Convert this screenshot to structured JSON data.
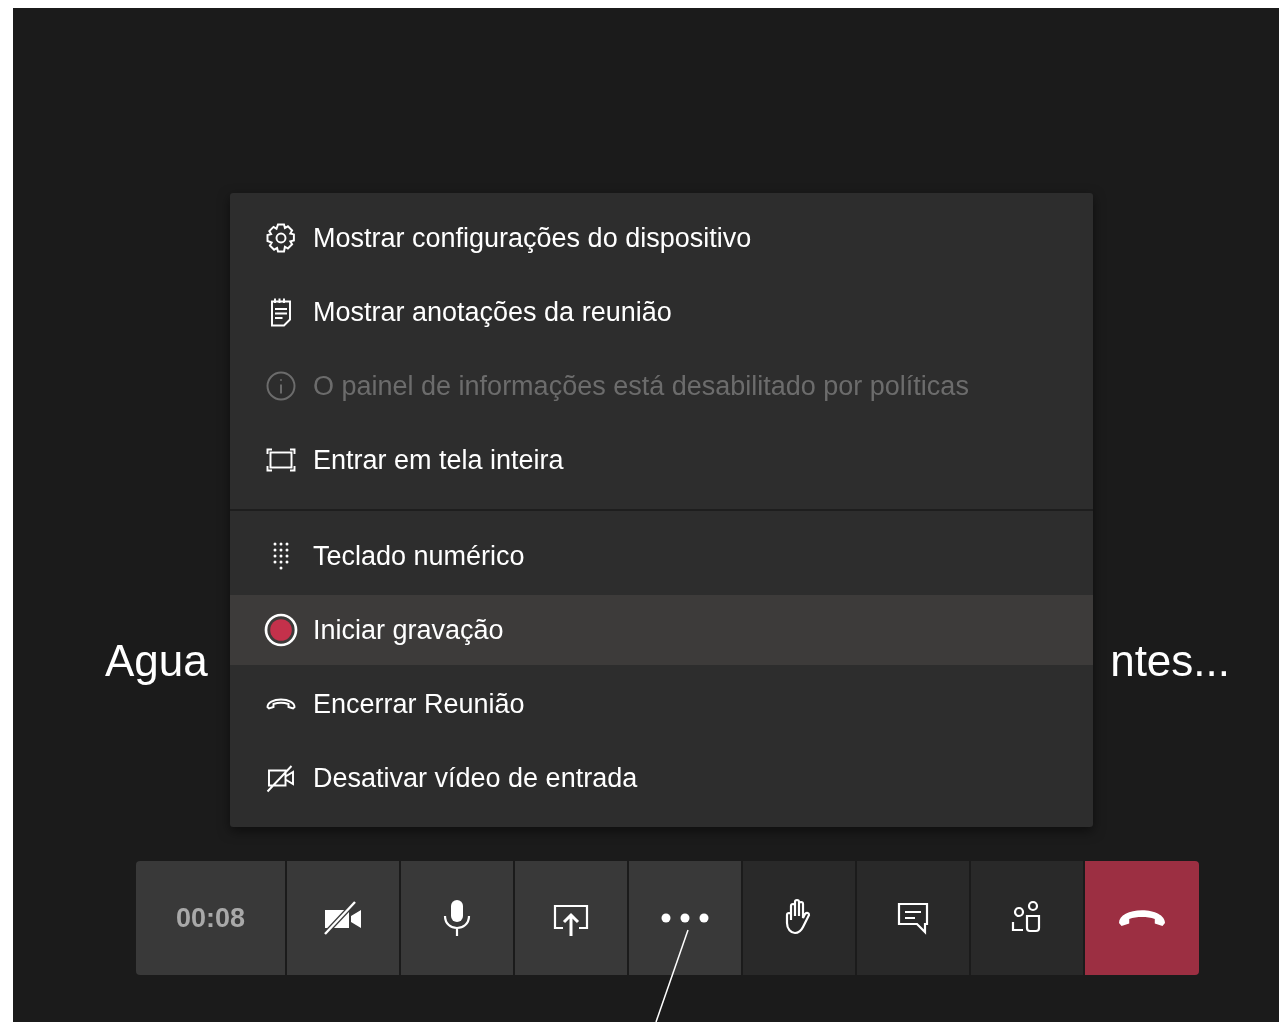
{
  "stage_title": {
    "left_part": "Agua",
    "right_part": "ntes..."
  },
  "menu": {
    "sections": [
      [
        {
          "label": "Mostrar configurações do dispositivo",
          "kind": "gear",
          "disabled": false,
          "highlighted": false
        },
        {
          "label": "Mostrar anotações da reunião",
          "kind": "notes",
          "disabled": false,
          "highlighted": false
        },
        {
          "label": "O painel de informações está desabilitado por políticas",
          "kind": "info",
          "disabled": true,
          "highlighted": false
        },
        {
          "label": "Entrar em tela inteira",
          "kind": "fullscreen",
          "disabled": false,
          "highlighted": false
        }
      ],
      [
        {
          "label": "Teclado numérico",
          "kind": "keypad",
          "disabled": false,
          "highlighted": false
        },
        {
          "label": "Iniciar gravação",
          "kind": "record",
          "disabled": false,
          "highlighted": true
        },
        {
          "label": "Encerrar Reunião",
          "kind": "hangup",
          "disabled": false,
          "highlighted": false
        },
        {
          "label": "Desativar vídeo de entrada",
          "kind": "video-off",
          "disabled": false,
          "highlighted": false
        }
      ]
    ]
  },
  "toolbar": {
    "timer": "00:08",
    "buttons": [
      {
        "kind": "camera-off",
        "highlighted": true
      },
      {
        "kind": "mic",
        "highlighted": true
      },
      {
        "kind": "share",
        "highlighted": true
      },
      {
        "kind": "more",
        "highlighted": true
      },
      {
        "kind": "raise-hand",
        "highlighted": false
      },
      {
        "kind": "chat",
        "highlighted": false
      },
      {
        "kind": "participants",
        "highlighted": false
      },
      {
        "kind": "leave"
      }
    ]
  }
}
